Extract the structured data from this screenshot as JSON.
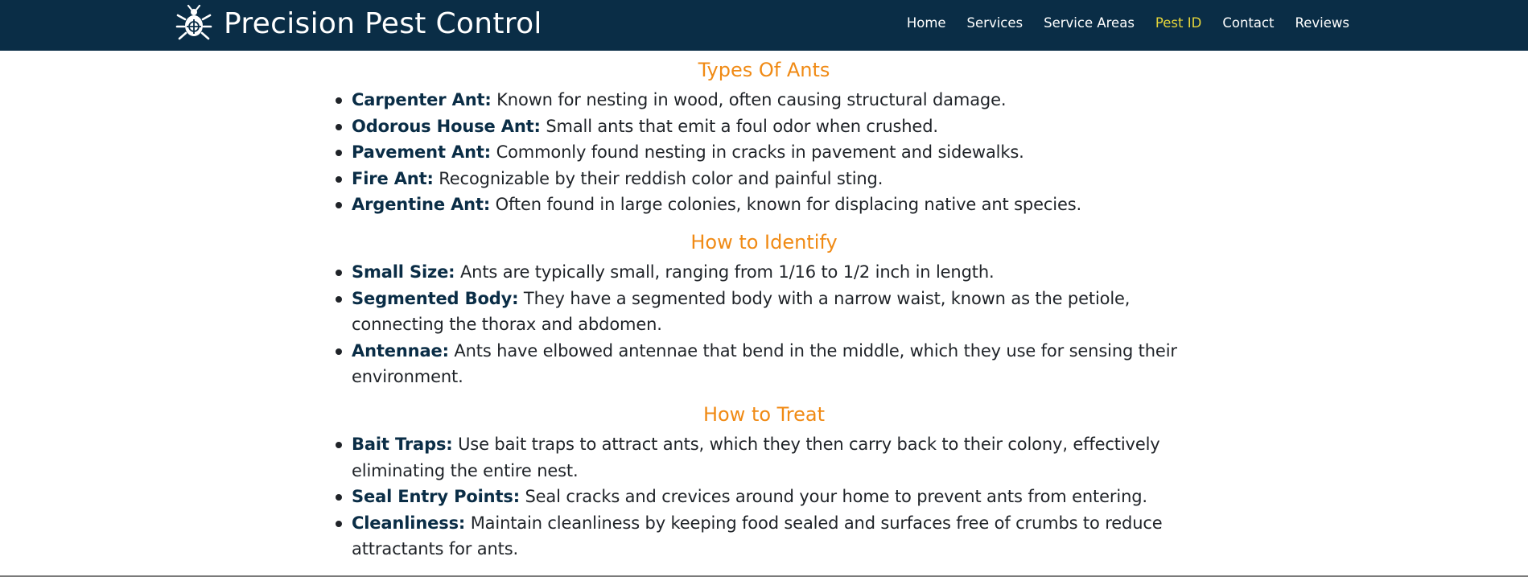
{
  "brand": {
    "name": "Precision Pest Control",
    "logo_icon": "bug-crosshair-icon"
  },
  "nav": [
    {
      "label": "Home",
      "active": false
    },
    {
      "label": "Services",
      "active": false
    },
    {
      "label": "Service Areas",
      "active": false
    },
    {
      "label": "Pest ID",
      "active": true
    },
    {
      "label": "Contact",
      "active": false
    },
    {
      "label": "Reviews",
      "active": false
    }
  ],
  "colors": {
    "navbar": "#0a2d46",
    "accent_heading": "#f08a14",
    "active_nav": "#e5d53a",
    "term": "#0a2d46"
  },
  "sections": [
    {
      "title": "Types Of Ants",
      "items": [
        {
          "term": "Carpenter Ant:",
          "desc": " Known for nesting in wood, often causing structural damage."
        },
        {
          "term": "Odorous House Ant:",
          "desc": " Small ants that emit a foul odor when crushed."
        },
        {
          "term": "Pavement Ant:",
          "desc": " Commonly found nesting in cracks in pavement and sidewalks."
        },
        {
          "term": "Fire Ant:",
          "desc": " Recognizable by their reddish color and painful sting."
        },
        {
          "term": "Argentine Ant:",
          "desc": " Often found in large colonies, known for displacing native ant species."
        }
      ]
    },
    {
      "title": "How to Identify",
      "items": [
        {
          "term": "Small Size:",
          "desc": " Ants are typically small, ranging from 1/16 to 1/2 inch in length."
        },
        {
          "term": "Segmented Body:",
          "desc": " They have a segmented body with a narrow waist, known as the petiole, connecting the thorax and abdomen."
        },
        {
          "term": "Antennae:",
          "desc": " Ants have elbowed antennae that bend in the middle, which they use for sensing their environment."
        }
      ]
    },
    {
      "title": "How to Treat",
      "items": [
        {
          "term": "Bait Traps:",
          "desc": " Use bait traps to attract ants, which they then carry back to their colony, effectively eliminating the entire nest."
        },
        {
          "term": "Seal Entry Points:",
          "desc": " Seal cracks and crevices around your home to prevent ants from entering."
        },
        {
          "term": "Cleanliness:",
          "desc": " Maintain cleanliness by keeping food sealed and surfaces free of crumbs to reduce attractants for ants."
        }
      ]
    }
  ]
}
